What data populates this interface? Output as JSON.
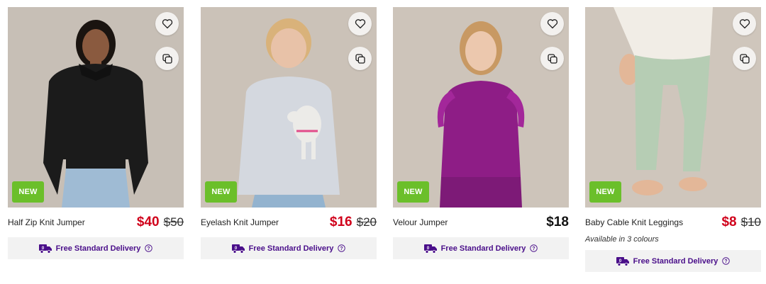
{
  "products": [
    {
      "name": "Half Zip Knit Jumper",
      "badge": "NEW",
      "price": "$40",
      "was": "$50",
      "delivery": "Free Standard Delivery",
      "scene_colors": {
        "bg": "#c7bfb6",
        "top": "#1b1b1b",
        "bottom": "#9fbbd4",
        "skin": "#8a5a3f",
        "hair": "#1a1410"
      }
    },
    {
      "name": "Eyelash Knit Jumper",
      "badge": "NEW",
      "price": "$16",
      "was": "$20",
      "delivery": "Free Standard Delivery",
      "scene_colors": {
        "bg": "#cbc2b8",
        "top": "#d4d8df",
        "bottom": "#93b3cf",
        "skin": "#e8c2a8",
        "hair": "#d9b27a"
      }
    },
    {
      "name": "Velour Jumper",
      "badge": "NEW",
      "price": "$18",
      "was": "",
      "delivery": "Free Standard Delivery",
      "scene_colors": {
        "bg": "#cdc4ba",
        "top": "#8e1d86",
        "bottom": "#7d1a77",
        "skin": "#ecc8ae",
        "hair": "#c89963"
      }
    },
    {
      "name": "Baby Cable Knit Leggings",
      "badge": "NEW",
      "price": "$8",
      "was": "$10",
      "availability": "Available in 3 colours",
      "delivery": "Free Standard Delivery",
      "scene_colors": {
        "bg": "#cfc6bc",
        "top": "#f1ede6",
        "bottom": "#b6cdb4",
        "skin": "#e3b798",
        "hair": "#000000"
      }
    }
  ],
  "icons": {
    "favourite": "heart-icon",
    "compare": "compare-icon",
    "delivery": "truck-icon",
    "help": "question-icon"
  },
  "colors": {
    "sale": "#d0021b",
    "badge": "#6bbf2a",
    "delivery_text": "#4a0f8a"
  }
}
